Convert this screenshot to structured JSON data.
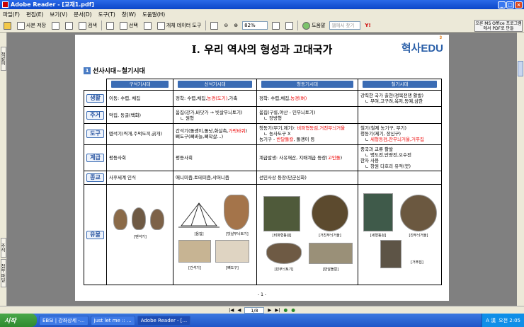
{
  "window": {
    "title": "Adobe Reader - [교재1.pdf]"
  },
  "menu": [
    "파일(F)",
    "편집(E)",
    "보기(V)",
    "문서(D)",
    "도구(T)",
    "창(W)",
    "도움말(H)"
  ],
  "toolbar": {
    "save_copy": "사본 저장",
    "search": "검색",
    "select": "선택",
    "object_tool": "개체 데이터 도구",
    "zoom": "82%",
    "help": "도움말",
    "search_placeholder": "웹에서 찾기",
    "ms_pdf": "오른 MS Office 프로그램에서 PDF로 만들"
  },
  "left_tabs": [
    "책갈피",
    "주석",
    "첨부 파일"
  ],
  "doc": {
    "title": "Ⅰ. 우리 역사의 형성과 고대국가",
    "logo": "혁사EDU",
    "logo_sub": "3",
    "section_num": "1",
    "section_title": "선사시대~철기시대",
    "eras": [
      "구석기시대",
      "신석기시대",
      "청동기시대",
      "철기시대"
    ],
    "rows": [
      {
        "label": "생활",
        "cells": [
          [
            "이동: 수렵, 채집"
          ],
          [
            "정착: 수렵,채집,|농경(도기)|,가축"
          ],
          [
            "정착: 수렵,채집,|농경(벼)"
          ],
          [
            "강력한 국가 출현(정복전쟁 활발)",
            "  ㄴ 부여,고구려,옥저,동예,삼한"
          ]
        ]
      },
      {
        "label": "주거",
        "cells": [
          [
            "막집, 동굴(백화)"
          ],
          [
            "움집(강가,바닷가 → 빗살무늬토기)",
            "  ㄴ 원형"
          ],
          [
            "움집(구릉,야산 - 민무늬토기)",
            "  ㄴ 장방형"
          ],
          []
        ]
      },
      {
        "label": "도구",
        "cells": [
          [
            "뗀석기(찍개,주먹도끼,긁개)"
          ],
          [
            "간석기(돌괭이,돌낫,화살촉,|가락바퀴|)",
            "뼈도구(뼈바늘,뼈작살...)"
          ],
          [
            "청동기(무기,제기): |비파형동검,거친무늬거울",
            "  ㄴ 농사도구 X",
            "농기구 - |반달돌칼|, 돌괭이 등"
          ],
          [
            "철기(철제 농기구, 무기)",
            "청동기(제기, 장신구)",
            "  ㄴ |세형동검,잔무늬거울,거푸집"
          ]
        ]
      },
      {
        "label": "계급",
        "cells": [
          [
            "평등사회"
          ],
          [
            "평등사회"
          ],
          [
            "계급발생: 사유재산, 지배계급 등장(|고인돌|)"
          ],
          [
            "중국과 교류 활발",
            "  ㄴ 명도전,반량전,오수전",
            "한자 사용",
            "  ㄴ 창원 다호리 유적(붓)"
          ]
        ]
      },
      {
        "label": "종교",
        "cells": [
          [
            "사후세계 인식"
          ],
          [
            "애니미즘,토테미즘,샤머니즘"
          ],
          [
            "선민사상 등장(단군신화)"
          ],
          []
        ]
      }
    ],
    "relic_label": "유물",
    "captions": [
      "[뗀석기]",
      "[움집]",
      "[빗살무늬토기]",
      "[간석기]",
      "[뼈도구]",
      "[비파형동검]",
      "[거친무늬거울]",
      "[민무늬토기]",
      "[반달돌칼]",
      "[세형동검]",
      "[잔무늬거울]",
      "[거푸집]"
    ],
    "page_num": "- 1 -"
  },
  "status": {
    "page": "1/8"
  },
  "taskbar": {
    "start": "시작",
    "tasks": [
      "EBSi | 강좌상세 -...",
      "just let me :: ...",
      "Adobe Reader - [..."
    ],
    "lang": "A 漢",
    "clock": "오전 2:05"
  }
}
